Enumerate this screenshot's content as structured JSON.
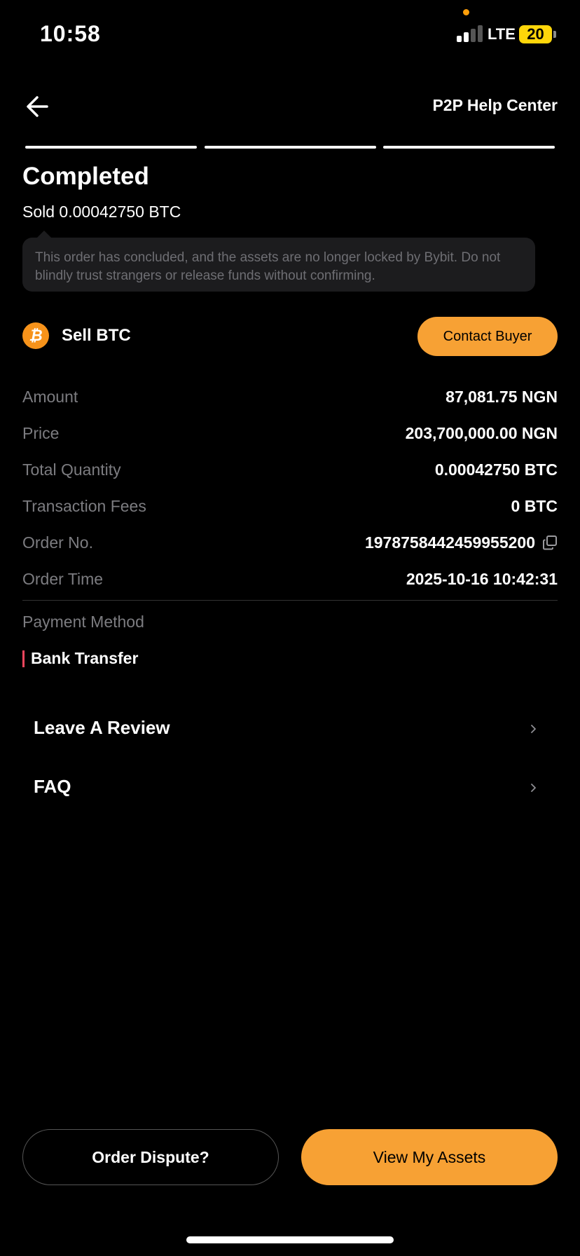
{
  "status_bar": {
    "time": "10:58",
    "network": "LTE",
    "battery": "20",
    "battery_color": "#ffd60a"
  },
  "header": {
    "back_icon": "arrow-left-icon",
    "help_center": "P2P Help Center"
  },
  "progress_steps": 3,
  "order": {
    "status": "Completed",
    "summary": "Sold 0.00042750 BTC",
    "notice": "This order has concluded, and the assets are no longer locked by Bybit. Do not blindly trust strangers or release funds without confirming.",
    "coin_icon": "bitcoin-icon",
    "coin_symbol": "₿",
    "side_label": "Sell BTC",
    "contact_button": "Contact Buyer"
  },
  "details": [
    {
      "label": "Amount",
      "value": "87,081.75 NGN"
    },
    {
      "label": "Price",
      "value": "203,700,000.00 NGN"
    },
    {
      "label": "Total Quantity",
      "value": "0.00042750 BTC"
    },
    {
      "label": "Transaction Fees",
      "value": "0 BTC"
    },
    {
      "label": "Order No.",
      "value": "1978758442459955200"
    },
    {
      "label": "Order Time",
      "value": "2025-10-16 10:42:31"
    }
  ],
  "payment": {
    "label": "Payment Method",
    "method": "Bank Transfer",
    "accent_color": "#f6465d"
  },
  "menu": [
    {
      "label": "Leave A Review",
      "icon": "chevron-right-icon"
    },
    {
      "label": "FAQ",
      "icon": "chevron-right-icon"
    }
  ],
  "footer": {
    "dispute_button": "Order Dispute?",
    "assets_button": "View My Assets",
    "accent_color": "#f7a134"
  }
}
